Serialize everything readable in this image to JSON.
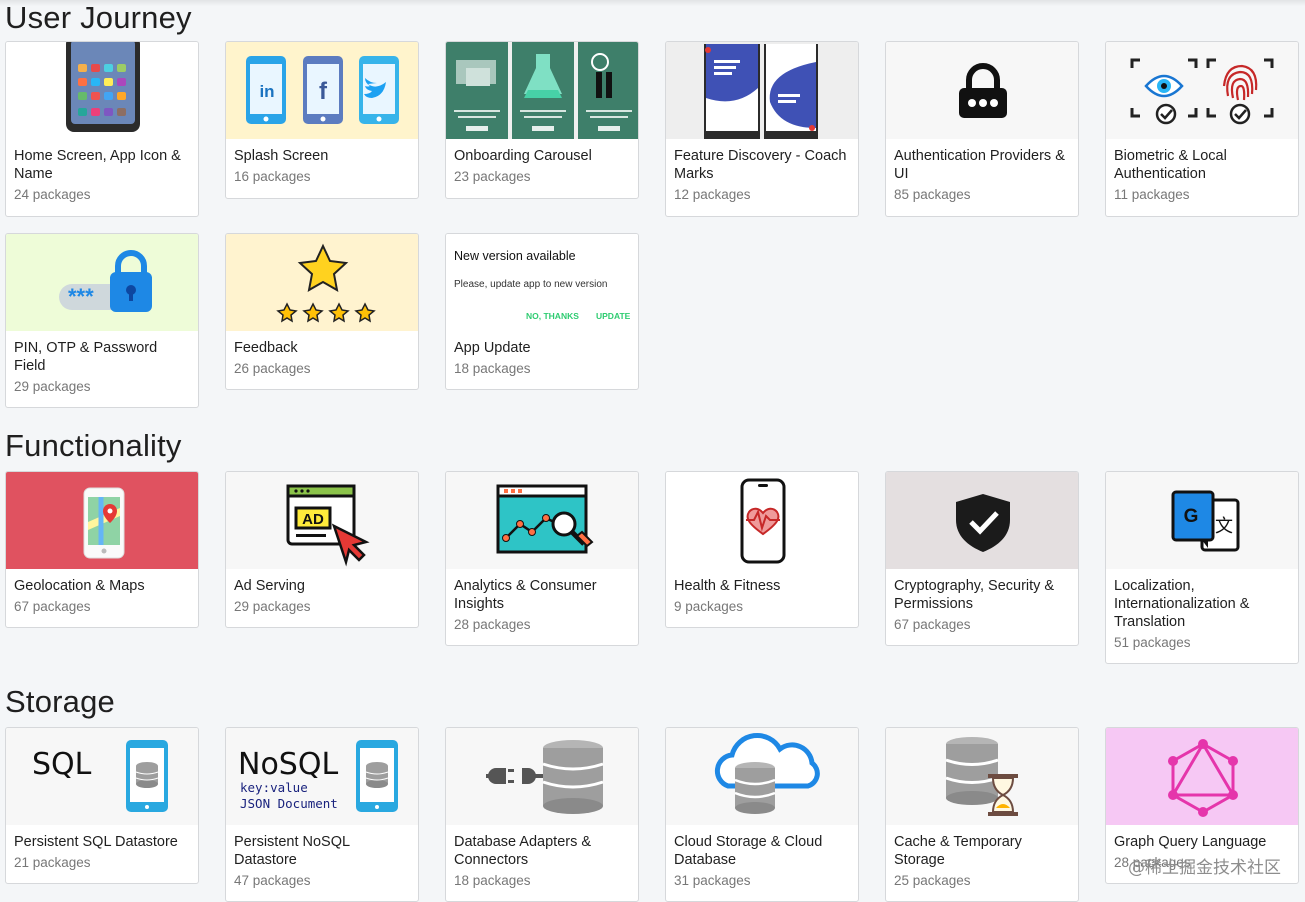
{
  "sections": [
    {
      "title": "User Journey",
      "cards": [
        {
          "name": "Home Screen, App Icon & Name",
          "count": "24 packages",
          "thumb": "home-screen",
          "bg": "#ffffff"
        },
        {
          "name": "Splash Screen",
          "count": "16 packages",
          "thumb": "splash-screen",
          "bg": "#fff4cc"
        },
        {
          "name": "Onboarding Carousel",
          "count": "23 packages",
          "thumb": "onboarding",
          "bg": "#3e7f6a"
        },
        {
          "name": "Feature Discovery - Coach Marks",
          "count": "12 packages",
          "thumb": "coach-marks",
          "bg": "#f1f1f1"
        },
        {
          "name": "Authentication Providers & UI",
          "count": "85 packages",
          "thumb": "lock",
          "bg": "#f7f7f7"
        },
        {
          "name": "Biometric & Local Authentication",
          "count": "11 packages",
          "thumb": "biometric",
          "bg": "#f7f7f7"
        },
        {
          "name": "PIN, OTP & Password Field",
          "count": "29 packages",
          "thumb": "pin",
          "bg": "#eefcd8"
        },
        {
          "name": "Feedback",
          "count": "26 packages",
          "thumb": "feedback",
          "bg": "#fff3cf"
        },
        {
          "name": "App Update",
          "count": "18 packages",
          "thumb": "app-update",
          "bg": "#ffffff"
        }
      ]
    },
    {
      "title": "Functionality",
      "cards": [
        {
          "name": "Geolocation & Maps",
          "count": "67 packages",
          "thumb": "maps",
          "bg": "#e05260"
        },
        {
          "name": "Ad Serving",
          "count": "29 packages",
          "thumb": "ad",
          "bg": "#f7f7f7"
        },
        {
          "name": "Analytics & Consumer Insights",
          "count": "28 packages",
          "thumb": "analytics",
          "bg": "#f7f7f7"
        },
        {
          "name": "Health & Fitness",
          "count": "9 packages",
          "thumb": "health",
          "bg": "#ffffff"
        },
        {
          "name": "Cryptography, Security & Permissions",
          "count": "67 packages",
          "thumb": "shield",
          "bg": "#e4dfe0"
        },
        {
          "name": "Localization, Internationalization & Translation",
          "count": "51 packages",
          "thumb": "translate",
          "bg": "#f7f7f7"
        }
      ]
    },
    {
      "title": "Storage",
      "cards": [
        {
          "name": "Persistent SQL Datastore",
          "count": "21 packages",
          "thumb": "sql",
          "bg": "#f7f7f7"
        },
        {
          "name": "Persistent NoSQL Datastore",
          "count": "47 packages",
          "thumb": "nosql",
          "bg": "#f7f7f7"
        },
        {
          "name": "Database Adapters & Connectors",
          "count": "18 packages",
          "thumb": "db-adapter",
          "bg": "#f7f7f7"
        },
        {
          "name": "Cloud Storage & Cloud Database",
          "count": "31 packages",
          "thumb": "cloud",
          "bg": "#f7f7f7"
        },
        {
          "name": "Cache & Temporary Storage",
          "count": "25 packages",
          "thumb": "cache",
          "bg": "#f7f7f7"
        },
        {
          "name": "Graph Query Language",
          "count": "28 packages",
          "thumb": "graphql",
          "bg": "#f6c8f4"
        }
      ]
    }
  ],
  "thumb_text": {
    "app_update_title": "New version available",
    "app_update_body": "Please, update app to new version",
    "app_update_no": "NO, THANKS",
    "app_update_yes": "UPDATE",
    "ad": "AD",
    "sql": "SQL",
    "nosql": "NoSQL",
    "nosql_kv": "key:value",
    "nosql_doc": "JSON Document",
    "linkedin": "in",
    "facebook": "f",
    "translate_g": "G",
    "translate_char": "文",
    "pin_mask": "***"
  },
  "watermark": "@稀土掘金技术社区",
  "colors": {
    "accent_green": "#2ecc71",
    "card_border": "#d6d8db",
    "count_gray": "#777777"
  }
}
